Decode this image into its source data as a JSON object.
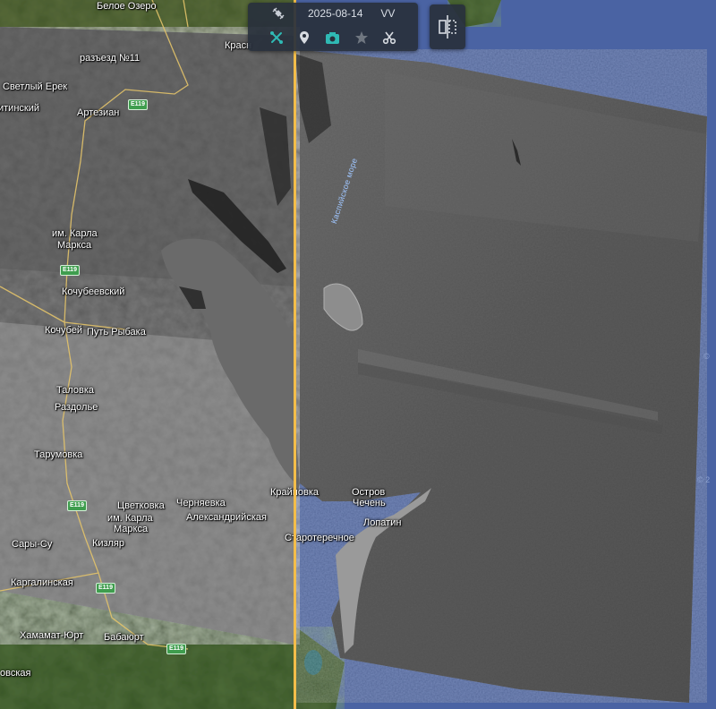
{
  "toolbar": {
    "date": "2025-08-14",
    "polarization": "VV",
    "icons": [
      "tools-icon",
      "satellite-dish-icon",
      "layer-pin-icon",
      "camera-icon",
      "star-icon",
      "scissors-icon"
    ]
  },
  "colors": {
    "ocean": "#4a63a3",
    "divider": "#f3bd4a",
    "active_icon": "#2fb9b4",
    "toolbar_bg": "#28303c"
  },
  "sea_label": "Каспийское море",
  "places": {
    "beloe_ozero": "Белое Озеро",
    "krasny": "Красн",
    "razezd": "разъезд №11",
    "svetly_erek": "Светлый Ерек",
    "tinsky": "итинский",
    "artezian": "Артезиан",
    "karla_marksa_1": "им. Карла",
    "karla_marksa_2": "Маркса",
    "kochubeevsky": "Кочубеевский",
    "kochubey": "Кочубей",
    "put_rybaka": "Путь Рыбака",
    "talovka": "Таловка",
    "razdolye": "Раздолье",
    "tarumovka": "Тарумовка",
    "tsvetkovka": "Цветковка",
    "chernyaevka": "Черняевка",
    "karla_marksa_3": "им. Карла",
    "karla_marksa_4": "Маркса",
    "aleksandriyskaya": "Александрийская",
    "krainovka": "Крайновка",
    "ostrov_1": "Остров",
    "ostrov_2": "Чечень",
    "lopatin": "Лопатин",
    "staroterechnoe": "Старотеречное",
    "sary_su": "Сары-Су",
    "kizlyar": "Кизляр",
    "kargalinskaya": "Каргалинская",
    "khamamat_yurt": "Хамамат-Юрт",
    "babayurt": "Бабаюрт",
    "ovskaya": "овская"
  },
  "shields": {
    "e119_a": "E119",
    "e119_b": "E119",
    "e119_c": "E119",
    "e119_d": "E119",
    "e119_e": "E119"
  },
  "edge_marks": {
    "right_1": "©",
    "right_2": "© 2"
  }
}
